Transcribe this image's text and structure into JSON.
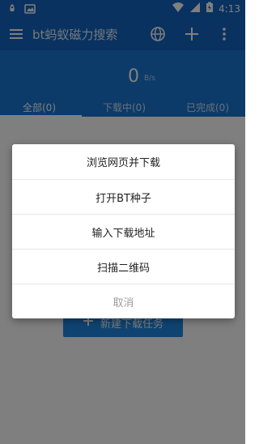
{
  "status_bar": {
    "time": "4:13"
  },
  "toolbar": {
    "title": "bt蚂蚁磁力搜索"
  },
  "speed": {
    "value": "0",
    "unit": "B/s"
  },
  "tabs": [
    {
      "label": "全部(0)"
    },
    {
      "label": "下载中(0)"
    },
    {
      "label": "已完成(0)"
    }
  ],
  "new_task": {
    "label": "新建下载任务"
  },
  "dialog": {
    "options": [
      {
        "label": "浏览网页并下载"
      },
      {
        "label": "打开BT种子"
      },
      {
        "label": "输入下载地址"
      },
      {
        "label": "扫描二维码"
      }
    ],
    "cancel": "取消"
  },
  "colors": {
    "primary": "#1565c0",
    "header": "#1976d2",
    "button": "#1e88e5"
  }
}
